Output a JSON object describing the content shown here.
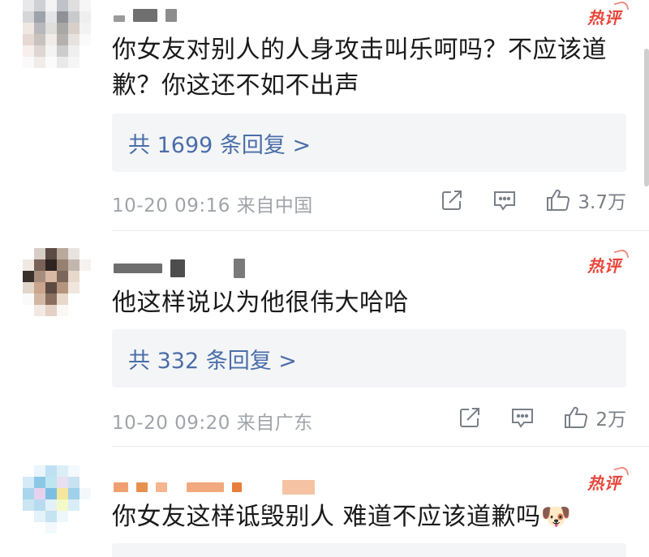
{
  "comments": [
    {
      "badge": "热评",
      "text": "你女友对别人的人身攻击叫乐呵吗？不应该道歉？你这还不如不出声",
      "reply_link": "共 1699 条回复 >",
      "meta": "10-20 09:16  来自中国",
      "likes": "3.7万",
      "avatar_colors": [
        "#e8e8ea",
        "#cfd0d4",
        "#f3f3f3",
        "#bfc2c8",
        "#e0dede",
        "#f6f6f6",
        "#d6d6d8",
        "#9ea3ab",
        "#e4e4e6",
        "#8f9196",
        "#c9cacc",
        "#eeeeee",
        "#f0e7e3",
        "#b7b8bc",
        "#dfdedb",
        "#a9a8a6",
        "#d9cfc9",
        "#f2f2f2",
        "#e6d8d2",
        "#c7c2be",
        "#f1ece8",
        "#b3b0ad",
        "#e8e2de",
        "#fafafa",
        "#f7efec",
        "#ddd6d1",
        "#f4f4f4",
        "#cccccc",
        "#efefef",
        "#ffffff",
        "#fafafa",
        "#f0ece9",
        "#fbfbfb",
        "#e9e9e9",
        "#f5f5f5",
        "#ffffff"
      ],
      "username_colors": [
        "#9a9a9a",
        "#6f6f6f",
        "#8d8d8d"
      ]
    },
    {
      "badge": "热评",
      "text": "他这样说以为他很伟大哈哈",
      "reply_link": "共 332 条回复 >",
      "meta": "10-20 09:20  来自广东",
      "likes": "2万",
      "avatar_colors": [
        "#ffffff",
        "#d7cdc6",
        "#5b4b45",
        "#b9a89c",
        "#e9e3de",
        "#ffffff",
        "#efe8e3",
        "#7a6257",
        "#2e2420",
        "#96806f",
        "#c3b6ad",
        "#f6f2ef",
        "#3a302c",
        "#a68d7d",
        "#d9b9a4",
        "#7c665c",
        "#e7d8cc",
        "#ffffff",
        "#e3d5cb",
        "#c9a58c",
        "#5d4a42",
        "#b6957f",
        "#f1e6de",
        "#ffffff",
        "#fafafa",
        "#d2b7a4",
        "#8a6f61",
        "#e8d7cb",
        "#ffffff",
        "#ffffff",
        "#ffffff",
        "#f2e9e3",
        "#e3d1c4",
        "#fbf7f4",
        "#ffffff",
        "#ffffff"
      ],
      "username_colors": [
        "#6e6e6e",
        "#4d4d4d",
        "#7a7a7a"
      ]
    },
    {
      "badge": "热评",
      "text": "你女友这样诋毁别人 难道不应该道歉吗🐶",
      "avatar_colors": [
        "#ffffff",
        "#e9f4fb",
        "#bfe0f2",
        "#dbeef8",
        "#f3f9fd",
        "#ffffff",
        "#d4ebf7",
        "#8cc7e6",
        "#bde6f1",
        "#e8dff0",
        "#c8e2f1",
        "#ffffff",
        "#a8d6ec",
        "#e6d2ef",
        "#7dbfe2",
        "#f5e79b",
        "#9fd1ea",
        "#f2f8fc",
        "#cbe5f3",
        "#b8dcef",
        "#e3f1f9",
        "#f3f9c9",
        "#d9edf8",
        "#ffffff",
        "#ffffff",
        "#e4f2fa",
        "#c6e3f2",
        "#eef7fc",
        "#ffffff",
        "#ffffff",
        "#ffffff",
        "#ffffff",
        "#f3f9fd",
        "#ffffff",
        "#ffffff",
        "#ffffff"
      ],
      "username_colors": [
        "#f0a070",
        "#e8914f",
        "#f4b58f",
        "#f2a97d",
        "#e87f3d",
        "#f5c3a3"
      ]
    }
  ]
}
